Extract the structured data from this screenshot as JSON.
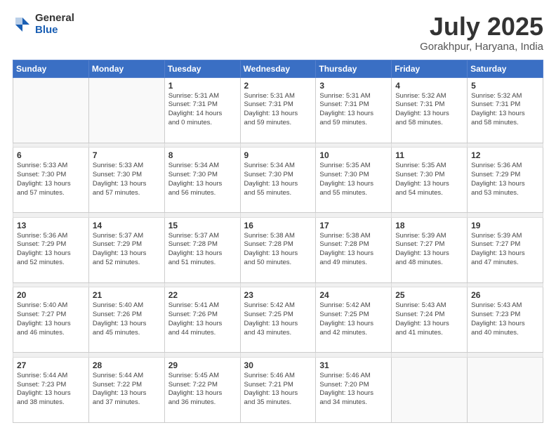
{
  "logo": {
    "general": "General",
    "blue": "Blue"
  },
  "header": {
    "title": "July 2025",
    "subtitle": "Gorakhpur, Haryana, India"
  },
  "weekdays": [
    "Sunday",
    "Monday",
    "Tuesday",
    "Wednesday",
    "Thursday",
    "Friday",
    "Saturday"
  ],
  "weeks": [
    [
      {
        "day": "",
        "info": ""
      },
      {
        "day": "",
        "info": ""
      },
      {
        "day": "1",
        "info": "Sunrise: 5:31 AM\nSunset: 7:31 PM\nDaylight: 14 hours\nand 0 minutes."
      },
      {
        "day": "2",
        "info": "Sunrise: 5:31 AM\nSunset: 7:31 PM\nDaylight: 13 hours\nand 59 minutes."
      },
      {
        "day": "3",
        "info": "Sunrise: 5:31 AM\nSunset: 7:31 PM\nDaylight: 13 hours\nand 59 minutes."
      },
      {
        "day": "4",
        "info": "Sunrise: 5:32 AM\nSunset: 7:31 PM\nDaylight: 13 hours\nand 58 minutes."
      },
      {
        "day": "5",
        "info": "Sunrise: 5:32 AM\nSunset: 7:31 PM\nDaylight: 13 hours\nand 58 minutes."
      }
    ],
    [
      {
        "day": "6",
        "info": "Sunrise: 5:33 AM\nSunset: 7:30 PM\nDaylight: 13 hours\nand 57 minutes."
      },
      {
        "day": "7",
        "info": "Sunrise: 5:33 AM\nSunset: 7:30 PM\nDaylight: 13 hours\nand 57 minutes."
      },
      {
        "day": "8",
        "info": "Sunrise: 5:34 AM\nSunset: 7:30 PM\nDaylight: 13 hours\nand 56 minutes."
      },
      {
        "day": "9",
        "info": "Sunrise: 5:34 AM\nSunset: 7:30 PM\nDaylight: 13 hours\nand 55 minutes."
      },
      {
        "day": "10",
        "info": "Sunrise: 5:35 AM\nSunset: 7:30 PM\nDaylight: 13 hours\nand 55 minutes."
      },
      {
        "day": "11",
        "info": "Sunrise: 5:35 AM\nSunset: 7:30 PM\nDaylight: 13 hours\nand 54 minutes."
      },
      {
        "day": "12",
        "info": "Sunrise: 5:36 AM\nSunset: 7:29 PM\nDaylight: 13 hours\nand 53 minutes."
      }
    ],
    [
      {
        "day": "13",
        "info": "Sunrise: 5:36 AM\nSunset: 7:29 PM\nDaylight: 13 hours\nand 52 minutes."
      },
      {
        "day": "14",
        "info": "Sunrise: 5:37 AM\nSunset: 7:29 PM\nDaylight: 13 hours\nand 52 minutes."
      },
      {
        "day": "15",
        "info": "Sunrise: 5:37 AM\nSunset: 7:28 PM\nDaylight: 13 hours\nand 51 minutes."
      },
      {
        "day": "16",
        "info": "Sunrise: 5:38 AM\nSunset: 7:28 PM\nDaylight: 13 hours\nand 50 minutes."
      },
      {
        "day": "17",
        "info": "Sunrise: 5:38 AM\nSunset: 7:28 PM\nDaylight: 13 hours\nand 49 minutes."
      },
      {
        "day": "18",
        "info": "Sunrise: 5:39 AM\nSunset: 7:27 PM\nDaylight: 13 hours\nand 48 minutes."
      },
      {
        "day": "19",
        "info": "Sunrise: 5:39 AM\nSunset: 7:27 PM\nDaylight: 13 hours\nand 47 minutes."
      }
    ],
    [
      {
        "day": "20",
        "info": "Sunrise: 5:40 AM\nSunset: 7:27 PM\nDaylight: 13 hours\nand 46 minutes."
      },
      {
        "day": "21",
        "info": "Sunrise: 5:40 AM\nSunset: 7:26 PM\nDaylight: 13 hours\nand 45 minutes."
      },
      {
        "day": "22",
        "info": "Sunrise: 5:41 AM\nSunset: 7:26 PM\nDaylight: 13 hours\nand 44 minutes."
      },
      {
        "day": "23",
        "info": "Sunrise: 5:42 AM\nSunset: 7:25 PM\nDaylight: 13 hours\nand 43 minutes."
      },
      {
        "day": "24",
        "info": "Sunrise: 5:42 AM\nSunset: 7:25 PM\nDaylight: 13 hours\nand 42 minutes."
      },
      {
        "day": "25",
        "info": "Sunrise: 5:43 AM\nSunset: 7:24 PM\nDaylight: 13 hours\nand 41 minutes."
      },
      {
        "day": "26",
        "info": "Sunrise: 5:43 AM\nSunset: 7:23 PM\nDaylight: 13 hours\nand 40 minutes."
      }
    ],
    [
      {
        "day": "27",
        "info": "Sunrise: 5:44 AM\nSunset: 7:23 PM\nDaylight: 13 hours\nand 38 minutes."
      },
      {
        "day": "28",
        "info": "Sunrise: 5:44 AM\nSunset: 7:22 PM\nDaylight: 13 hours\nand 37 minutes."
      },
      {
        "day": "29",
        "info": "Sunrise: 5:45 AM\nSunset: 7:22 PM\nDaylight: 13 hours\nand 36 minutes."
      },
      {
        "day": "30",
        "info": "Sunrise: 5:46 AM\nSunset: 7:21 PM\nDaylight: 13 hours\nand 35 minutes."
      },
      {
        "day": "31",
        "info": "Sunrise: 5:46 AM\nSunset: 7:20 PM\nDaylight: 13 hours\nand 34 minutes."
      },
      {
        "day": "",
        "info": ""
      },
      {
        "day": "",
        "info": ""
      }
    ]
  ]
}
